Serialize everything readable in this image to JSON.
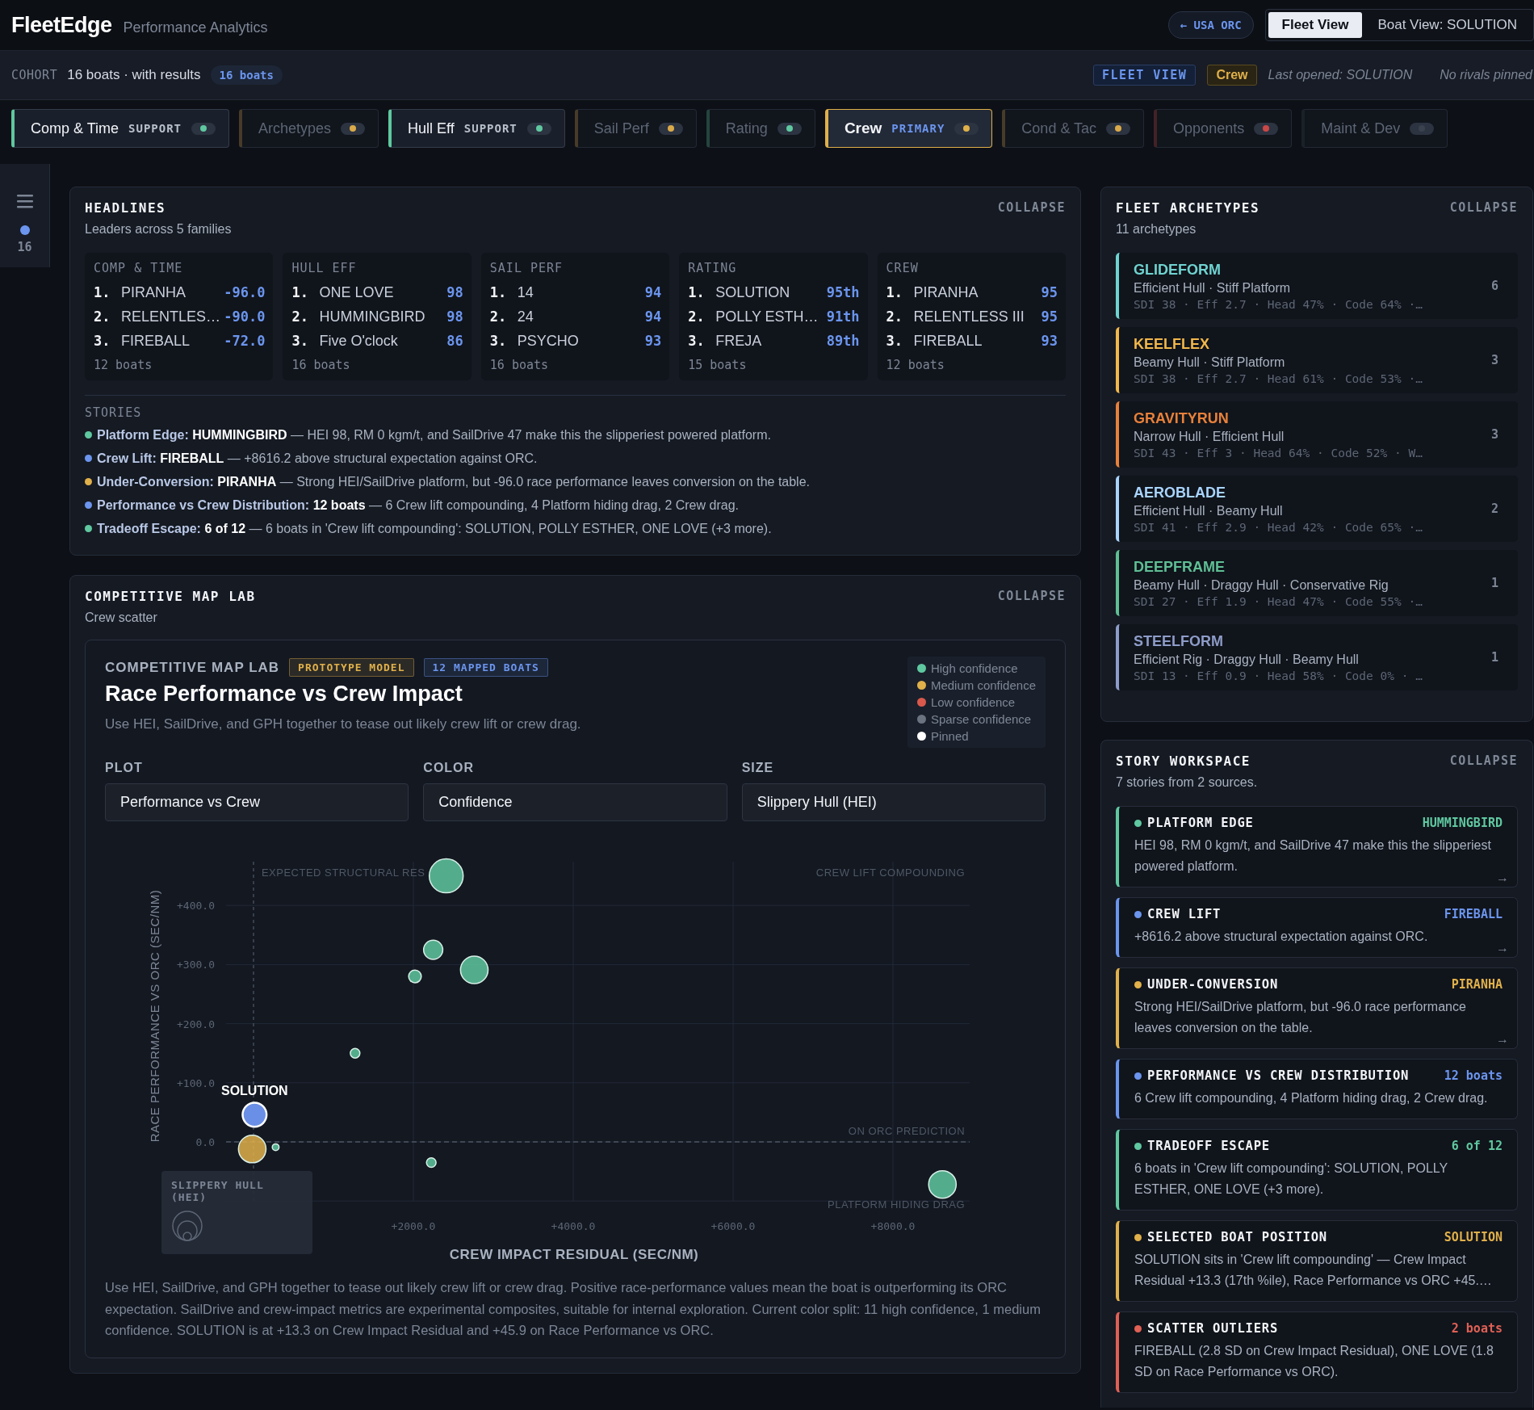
{
  "header": {
    "brand": "FleetEdge",
    "subtitle": "Performance Analytics",
    "back_button": "← USA ORC",
    "views": [
      {
        "label": "Fleet View",
        "selected": true
      },
      {
        "label": "Boat View: SOLUTION",
        "selected": false
      }
    ]
  },
  "cohort": {
    "label": "COHORT",
    "summary": "16 boats · with results",
    "badge": "16 boats",
    "view_badge": "FLEET VIEW",
    "family_badge": "Crew",
    "last_opened": "Last opened: SOLUTION",
    "rivals": "No rivals pinned"
  },
  "tabs": [
    {
      "label": "Comp & Time",
      "role": "SUPPORT",
      "active": true,
      "selected": false,
      "color": "#5fc8a0"
    },
    {
      "label": "Archetypes",
      "active": false,
      "selected": false,
      "color": "#d9a94a"
    },
    {
      "label": "Hull Eff",
      "role": "SUPPORT",
      "active": true,
      "selected": false,
      "color": "#5fc8a0"
    },
    {
      "label": "Sail Perf",
      "active": false,
      "selected": false,
      "color": "#d9a94a"
    },
    {
      "label": "Rating",
      "active": false,
      "selected": false,
      "color": "#5fc8a0"
    },
    {
      "label": "Crew",
      "role": "PRIMARY",
      "active": true,
      "selected": true,
      "color": "#e0b04a"
    },
    {
      "label": "Cond & Tac",
      "active": false,
      "selected": false,
      "color": "#d9a94a"
    },
    {
      "label": "Opponents",
      "active": false,
      "selected": false,
      "color": "#c94848"
    },
    {
      "label": "Maint & Dev",
      "active": false,
      "selected": false,
      "color": "#3a4250"
    }
  ],
  "rail": {
    "count": "16"
  },
  "headlines": {
    "title": "HEADLINES",
    "subtitle": "Leaders across 5 families",
    "collapse": "COLLAPSE",
    "families": [
      {
        "name": "COMP & TIME",
        "leaders": [
          {
            "rank": "1.",
            "boat": "PIRANHA",
            "value": "-96.0"
          },
          {
            "rank": "2.",
            "boat": "RELENTLES…",
            "value": "-90.0"
          },
          {
            "rank": "3.",
            "boat": "FIREBALL",
            "value": "-72.0"
          }
        ],
        "count": "12 boats"
      },
      {
        "name": "HULL EFF",
        "leaders": [
          {
            "rank": "1.",
            "boat": "ONE LOVE",
            "value": "98"
          },
          {
            "rank": "2.",
            "boat": "HUMMINGBIRD",
            "value": "98"
          },
          {
            "rank": "3.",
            "boat": "Five O'clock",
            "value": "86"
          }
        ],
        "count": "16 boats"
      },
      {
        "name": "SAIL PERF",
        "leaders": [
          {
            "rank": "1.",
            "boat": "14",
            "value": "94"
          },
          {
            "rank": "2.",
            "boat": "24",
            "value": "94"
          },
          {
            "rank": "3.",
            "boat": "PSYCHO",
            "value": "93"
          }
        ],
        "count": "16 boats"
      },
      {
        "name": "RATING",
        "leaders": [
          {
            "rank": "1.",
            "boat": "SOLUTION",
            "value": "95th"
          },
          {
            "rank": "2.",
            "boat": "POLLY ESTH…",
            "value": "91th"
          },
          {
            "rank": "3.",
            "boat": "FREJA",
            "value": "89th"
          }
        ],
        "count": "15 boats"
      },
      {
        "name": "CREW",
        "leaders": [
          {
            "rank": "1.",
            "boat": "PIRANHA",
            "value": "95"
          },
          {
            "rank": "2.",
            "boat": "RELENTLESS III",
            "value": "95"
          },
          {
            "rank": "3.",
            "boat": "FIREBALL",
            "value": "93"
          }
        ],
        "count": "12 boats"
      }
    ],
    "stories_label": "STORIES",
    "stories": [
      {
        "color": "#5fc8a0",
        "lead": "Platform Edge:",
        "text": "**HUMMINGBIRD** — HEI 98, RM 0 kgm/t, and SailDrive 47 make this the slipperiest powered platform."
      },
      {
        "color": "#6b95ee",
        "lead": "Crew Lift:",
        "text": "**FIREBALL** — +8616.2 above structural expectation against ORC."
      },
      {
        "color": "#e0b04a",
        "lead": "Under-Conversion:",
        "text": "**PIRANHA** — Strong HEI/SailDrive platform, but -96.0 race performance leaves conversion on the table."
      },
      {
        "color": "#6b95ee",
        "lead": "Performance vs Crew Distribution:",
        "text": "**12 boats** — 6 Crew lift compounding, 4 Platform hiding drag, 2 Crew drag."
      },
      {
        "color": "#5fc8a0",
        "lead": "Tradeoff Escape:",
        "text": "**6 of 12** — 6 boats in 'Crew lift compounding': SOLUTION, POLLY ESTHER, ONE LOVE (+3 more)."
      }
    ]
  },
  "map_lab": {
    "title": "COMPETITIVE MAP LAB",
    "subtitle": "Crew scatter",
    "collapse": "COLLAPSE",
    "eyebrow": "COMPETITIVE MAP LAB",
    "badges": [
      {
        "text": "PROTOTYPE MODEL",
        "color": "#e0b04a"
      },
      {
        "text": "12 MAPPED BOATS",
        "color": "#6b95ee"
      }
    ],
    "heading": "Race Performance vs Crew Impact",
    "description": "Use HEI, SailDrive, and GPH together to tease out likely crew lift or crew drag.",
    "controls": [
      {
        "label": "PLOT",
        "value": "Performance vs Crew"
      },
      {
        "label": "COLOR",
        "value": "Confidence"
      },
      {
        "label": "SIZE",
        "value": "Slippery Hull (HEI)"
      }
    ],
    "size_legend": {
      "title": "SLIPPERY HULL (HEI)"
    },
    "chart_data": {
      "type": "scatter",
      "grid": true,
      "ref_lines": [
        {
          "axis": "x",
          "value": 0
        },
        {
          "axis": "y",
          "value": 0
        }
      ],
      "xlabel": "CREW IMPACT RESIDUAL (SEC/NM)",
      "ylabel": "RACE PERFORMANCE VS ORC (SEC/NM)",
      "xlim": [
        -343,
        8960
      ],
      "ylim": [
        -100,
        474
      ],
      "xticks": [
        {
          "value": 2000,
          "label": "+2000.0"
        },
        {
          "value": 4000,
          "label": "+4000.0"
        },
        {
          "value": 6000,
          "label": "+6000.0"
        },
        {
          "value": 8000,
          "label": "+8000.0"
        }
      ],
      "yticks": [
        {
          "value": 0,
          "label": "0.0"
        },
        {
          "value": 100,
          "label": "+100.0"
        },
        {
          "value": 200,
          "label": "+200.0"
        },
        {
          "value": 300,
          "label": "+300.0"
        },
        {
          "value": 400,
          "label": "+400.0"
        }
      ],
      "x": [
        2411,
        2248,
        2762,
        2020,
        1271,
        277,
        2224,
        8619,
        -16,
        13.3
      ],
      "series": [
        {
          "name": "High confidence",
          "color": "#5fc8a0",
          "values": [
            450,
            325,
            291,
            280,
            150,
            -9,
            -35,
            -72,
            null,
            null
          ],
          "sizes": [
            1,
            0.32,
            0.66,
            0.14,
            0.08,
            0.04,
            0.08,
            0.66,
            null,
            null
          ]
        },
        {
          "name": "Medium confidence",
          "color": "#e0b04a",
          "values": [
            null,
            null,
            null,
            null,
            null,
            null,
            null,
            null,
            -12,
            null
          ],
          "sizes": [
            null,
            null,
            null,
            null,
            null,
            null,
            null,
            null,
            0.66,
            null
          ]
        },
        {
          "name": "Low confidence",
          "color": "#d9594c",
          "values": [
            null,
            null,
            null,
            null,
            null,
            null,
            null,
            null,
            null,
            null
          ]
        },
        {
          "name": "Sparse confidence",
          "color": "#6b7280",
          "values": [
            null,
            null,
            null,
            null,
            null,
            null,
            null,
            null,
            null,
            null
          ]
        },
        {
          "name": "Pinned",
          "color": "#ffffff",
          "values": [
            null,
            null,
            null,
            null,
            null,
            null,
            null,
            null,
            null,
            46
          ],
          "sizes": [
            null,
            null,
            null,
            null,
            null,
            null,
            null,
            null,
            null,
            0.5
          ]
        }
      ],
      "annotations": [
        "EXPECTED STRUCTURAL RES",
        "CREW LIFT COMPOUNDING",
        "ON ORC PREDICTION",
        "PLATFORM HIDING DRAG",
        {
          "text": "SOLUTION",
          "x": 13.3,
          "y": 46
        }
      ]
    },
    "footnote": "Use HEI, SailDrive, and GPH together to tease out likely crew lift or crew drag. Positive race-performance values mean the boat is outperforming its ORC expectation. SailDrive and crew-impact metrics are experimental composites, suitable for internal exploration. Current color split: 11 high confidence, 1 medium confidence. SOLUTION is at +13.3 on Crew Impact Residual and +45.9 on Race Performance vs ORC."
  },
  "archetypes": {
    "title": "FLEET ARCHETYPES",
    "subtitle": "11 archetypes",
    "collapse": "COLLAPSE",
    "items": [
      {
        "name": "GLIDEFORM",
        "traits": "Efficient Hull · Stiff Platform",
        "stats": "SDI 38 · Eff 2.7 · Head 47% · Code 64% ·…",
        "count": "6",
        "color": "#6fd3d0"
      },
      {
        "name": "KEELFLEX",
        "traits": "Beamy Hull · Stiff Platform",
        "stats": "SDI 38 · Eff 2.7 · Head 61% · Code 53% ·…",
        "count": "3",
        "color": "#f2b84b"
      },
      {
        "name": "GRAVITYRUN",
        "traits": "Narrow Hull · Efficient Hull",
        "stats": "SDI 43 · Eff 3 · Head 64% · Code 52% · W…",
        "count": "3",
        "color": "#e8813a"
      },
      {
        "name": "AEROBLADE",
        "traits": "Efficient Hull · Beamy Hull",
        "stats": "SDI 41 · Eff 2.9 · Head 42% · Code 65% ·…",
        "count": "2",
        "color": "#a8d4ff"
      },
      {
        "name": "DEEPFRAME",
        "traits": "Beamy Hull · Draggy Hull · Conservative Rig",
        "stats": "SDI 27 · Eff 1.9 · Head 47% · Code 55% ·…",
        "count": "1",
        "color": "#5fbf95"
      },
      {
        "name": "STEELFORM",
        "traits": "Efficient Rig · Draggy Hull · Beamy Hull",
        "stats": "SDI 13 · Eff 0.9 · Head 58% · Code 0% · …",
        "count": "1",
        "color": "#8d9cc8"
      }
    ]
  },
  "workspace": {
    "title": "STORY WORKSPACE",
    "subtitle": "7 stories from 2 sources.",
    "collapse": "COLLAPSE",
    "stories": [
      {
        "title": "PLATFORM EDGE",
        "tag": "HUMMINGBIRD",
        "body": "HEI 98, RM 0 kgm/t, and SailDrive 47 make this the slipperiest powered platform.",
        "arrow": "→",
        "color": "#5fc8a0"
      },
      {
        "title": "CREW LIFT",
        "tag": "FIREBALL",
        "body": "+8616.2 above structural expectation against ORC.",
        "arrow": "→",
        "color": "#6b95ee"
      },
      {
        "title": "UNDER-CONVERSION",
        "tag": "PIRANHA",
        "body": "Strong HEI/SailDrive platform, but -96.0 race performance leaves conversion on the table.",
        "arrow": "→",
        "color": "#e0b04a"
      },
      {
        "title": "PERFORMANCE VS CREW DISTRIBUTION",
        "tag": "12 boats",
        "body": "6 Crew lift compounding, 4 Platform hiding drag, 2 Crew drag.",
        "color": "#6b95ee"
      },
      {
        "title": "TRADEOFF ESCAPE",
        "tag": "6 of 12",
        "body": "6 boats in 'Crew lift compounding': SOLUTION, POLLY ESTHER, ONE LOVE (+3 more).",
        "color": "#5fc8a0"
      },
      {
        "title": "SELECTED BOAT POSITION",
        "tag": "SOLUTION",
        "body": "SOLUTION sits in 'Crew lift compounding' — Crew Impact Residual +13.3 (17th %ile), Race Performance vs ORC +45.…",
        "color": "#e0b04a"
      },
      {
        "title": "SCATTER OUTLIERS",
        "tag": "2 boats",
        "body": "FIREBALL (2.8 SD on Crew Impact Residual), ONE LOVE (1.8 SD on Race Performance vs ORC).",
        "color": "#e06055"
      }
    ]
  }
}
